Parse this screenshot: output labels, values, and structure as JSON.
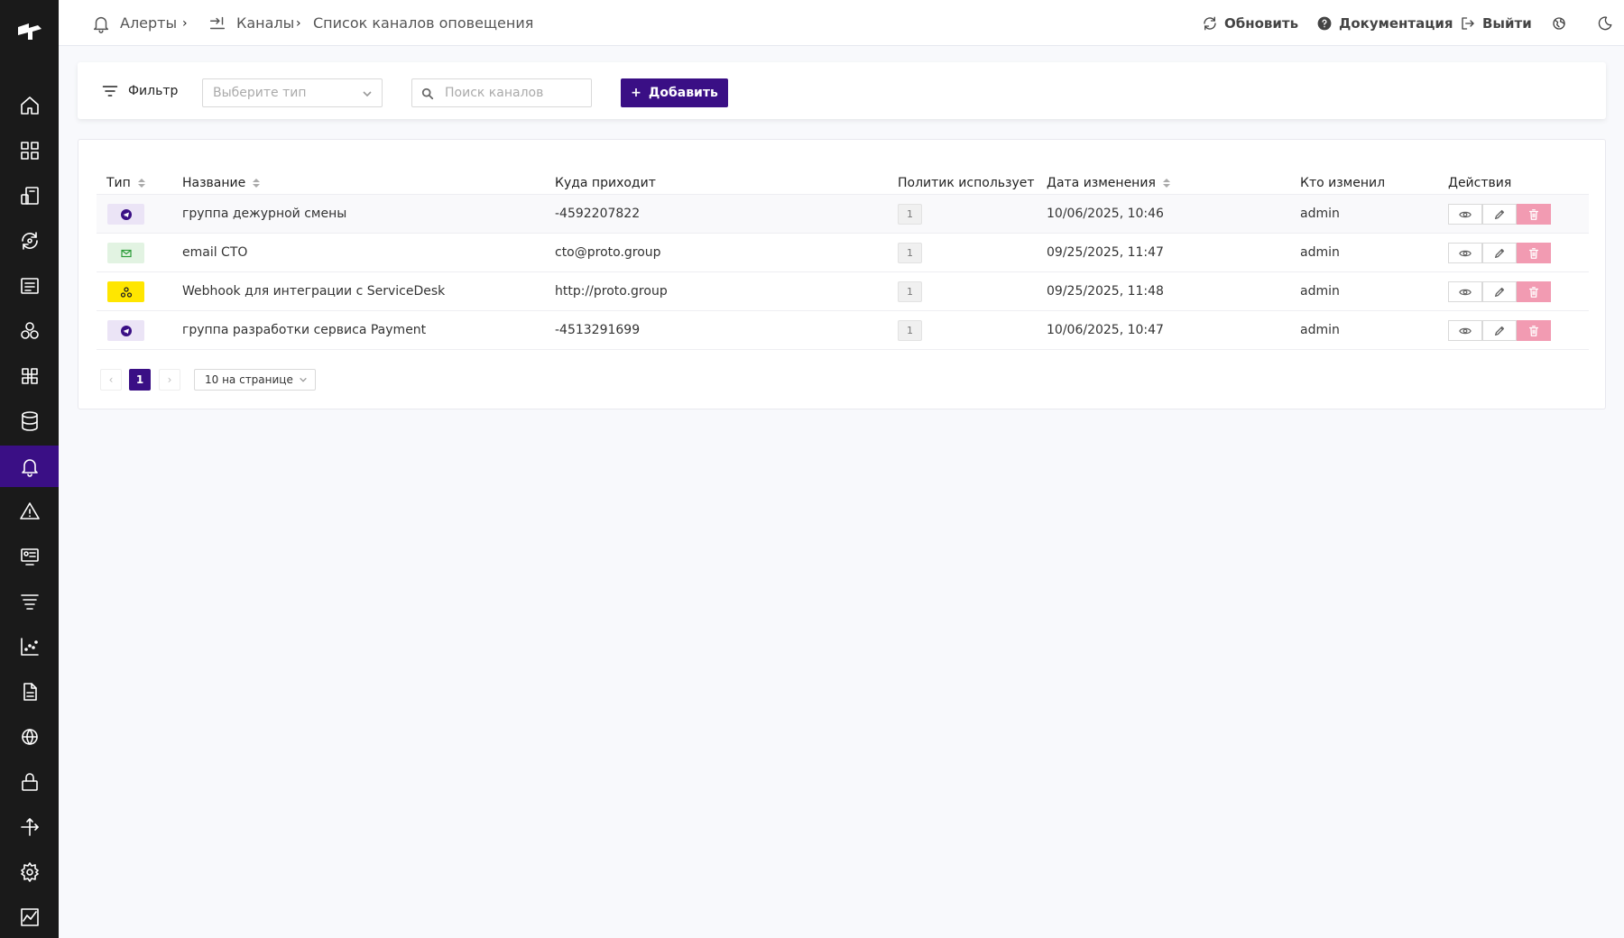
{
  "sidebar": {
    "logo_icon": "proto-logo-icon",
    "items": [
      {
        "icon": "home-icon"
      },
      {
        "icon": "dashboards-icon"
      },
      {
        "icon": "devices-icon"
      },
      {
        "icon": "sync-icon"
      },
      {
        "icon": "list-icon"
      },
      {
        "icon": "components-icon"
      },
      {
        "icon": "command-icon"
      },
      {
        "icon": "database-icon"
      },
      {
        "icon": "bell-icon",
        "active": true
      },
      {
        "icon": "warning-icon"
      },
      {
        "icon": "reports-icon"
      },
      {
        "icon": "filter-list-icon"
      },
      {
        "icon": "chart-icon"
      },
      {
        "icon": "document-icon"
      },
      {
        "icon": "globe-icon"
      },
      {
        "icon": "lock-icon"
      },
      {
        "icon": "routes-icon"
      },
      {
        "icon": "settings-icon"
      },
      {
        "icon": "activity-icon"
      }
    ]
  },
  "header": {
    "breadcrumb": {
      "alerts": "Алерты",
      "channels": "Каналы",
      "current": "Список каналов оповещения"
    },
    "refresh": "Обновить",
    "docs": "Документация",
    "logout": "Выйти"
  },
  "filter": {
    "label": "Фильтр",
    "type_placeholder": "Выберите тип",
    "search_placeholder": "Поиск каналов",
    "add_label": "Добавить"
  },
  "table": {
    "columns": {
      "type": "Тип",
      "name": "Название",
      "destination": "Куда приходит",
      "policies": "Политик использует",
      "modified": "Дата изменения",
      "author": "Кто изменил",
      "actions": "Действия"
    },
    "rows": [
      {
        "type": "telegram",
        "name": "группа дежурной смены",
        "destination": "-4592207822",
        "policies": "1",
        "modified": "10/06/2025, 10:46",
        "author": "admin"
      },
      {
        "type": "email",
        "name": "email CTO",
        "destination": "cto@proto.group",
        "policies": "1",
        "modified": "09/25/2025, 11:47",
        "author": "admin"
      },
      {
        "type": "webhook",
        "name": "Webhook для интеграции с ServiceDesk",
        "destination": "http://proto.group",
        "policies": "1",
        "modified": "09/25/2025, 11:48",
        "author": "admin"
      },
      {
        "type": "telegram",
        "name": "группа разработки сервиса Payment",
        "destination": "-4513291699",
        "policies": "1",
        "modified": "10/06/2025, 10:47",
        "author": "admin"
      }
    ]
  },
  "pagination": {
    "prev": "‹",
    "current": "1",
    "next": "›",
    "page_size": "10 на странице"
  },
  "colors": {
    "accent": "#3a0f85",
    "sidebar": "#1a1a1a",
    "telegram_bg": "#ebe4f6",
    "email_bg": "#e2f3e2",
    "webhook_bg": "#ffe600",
    "delete": "#f29bb2"
  }
}
